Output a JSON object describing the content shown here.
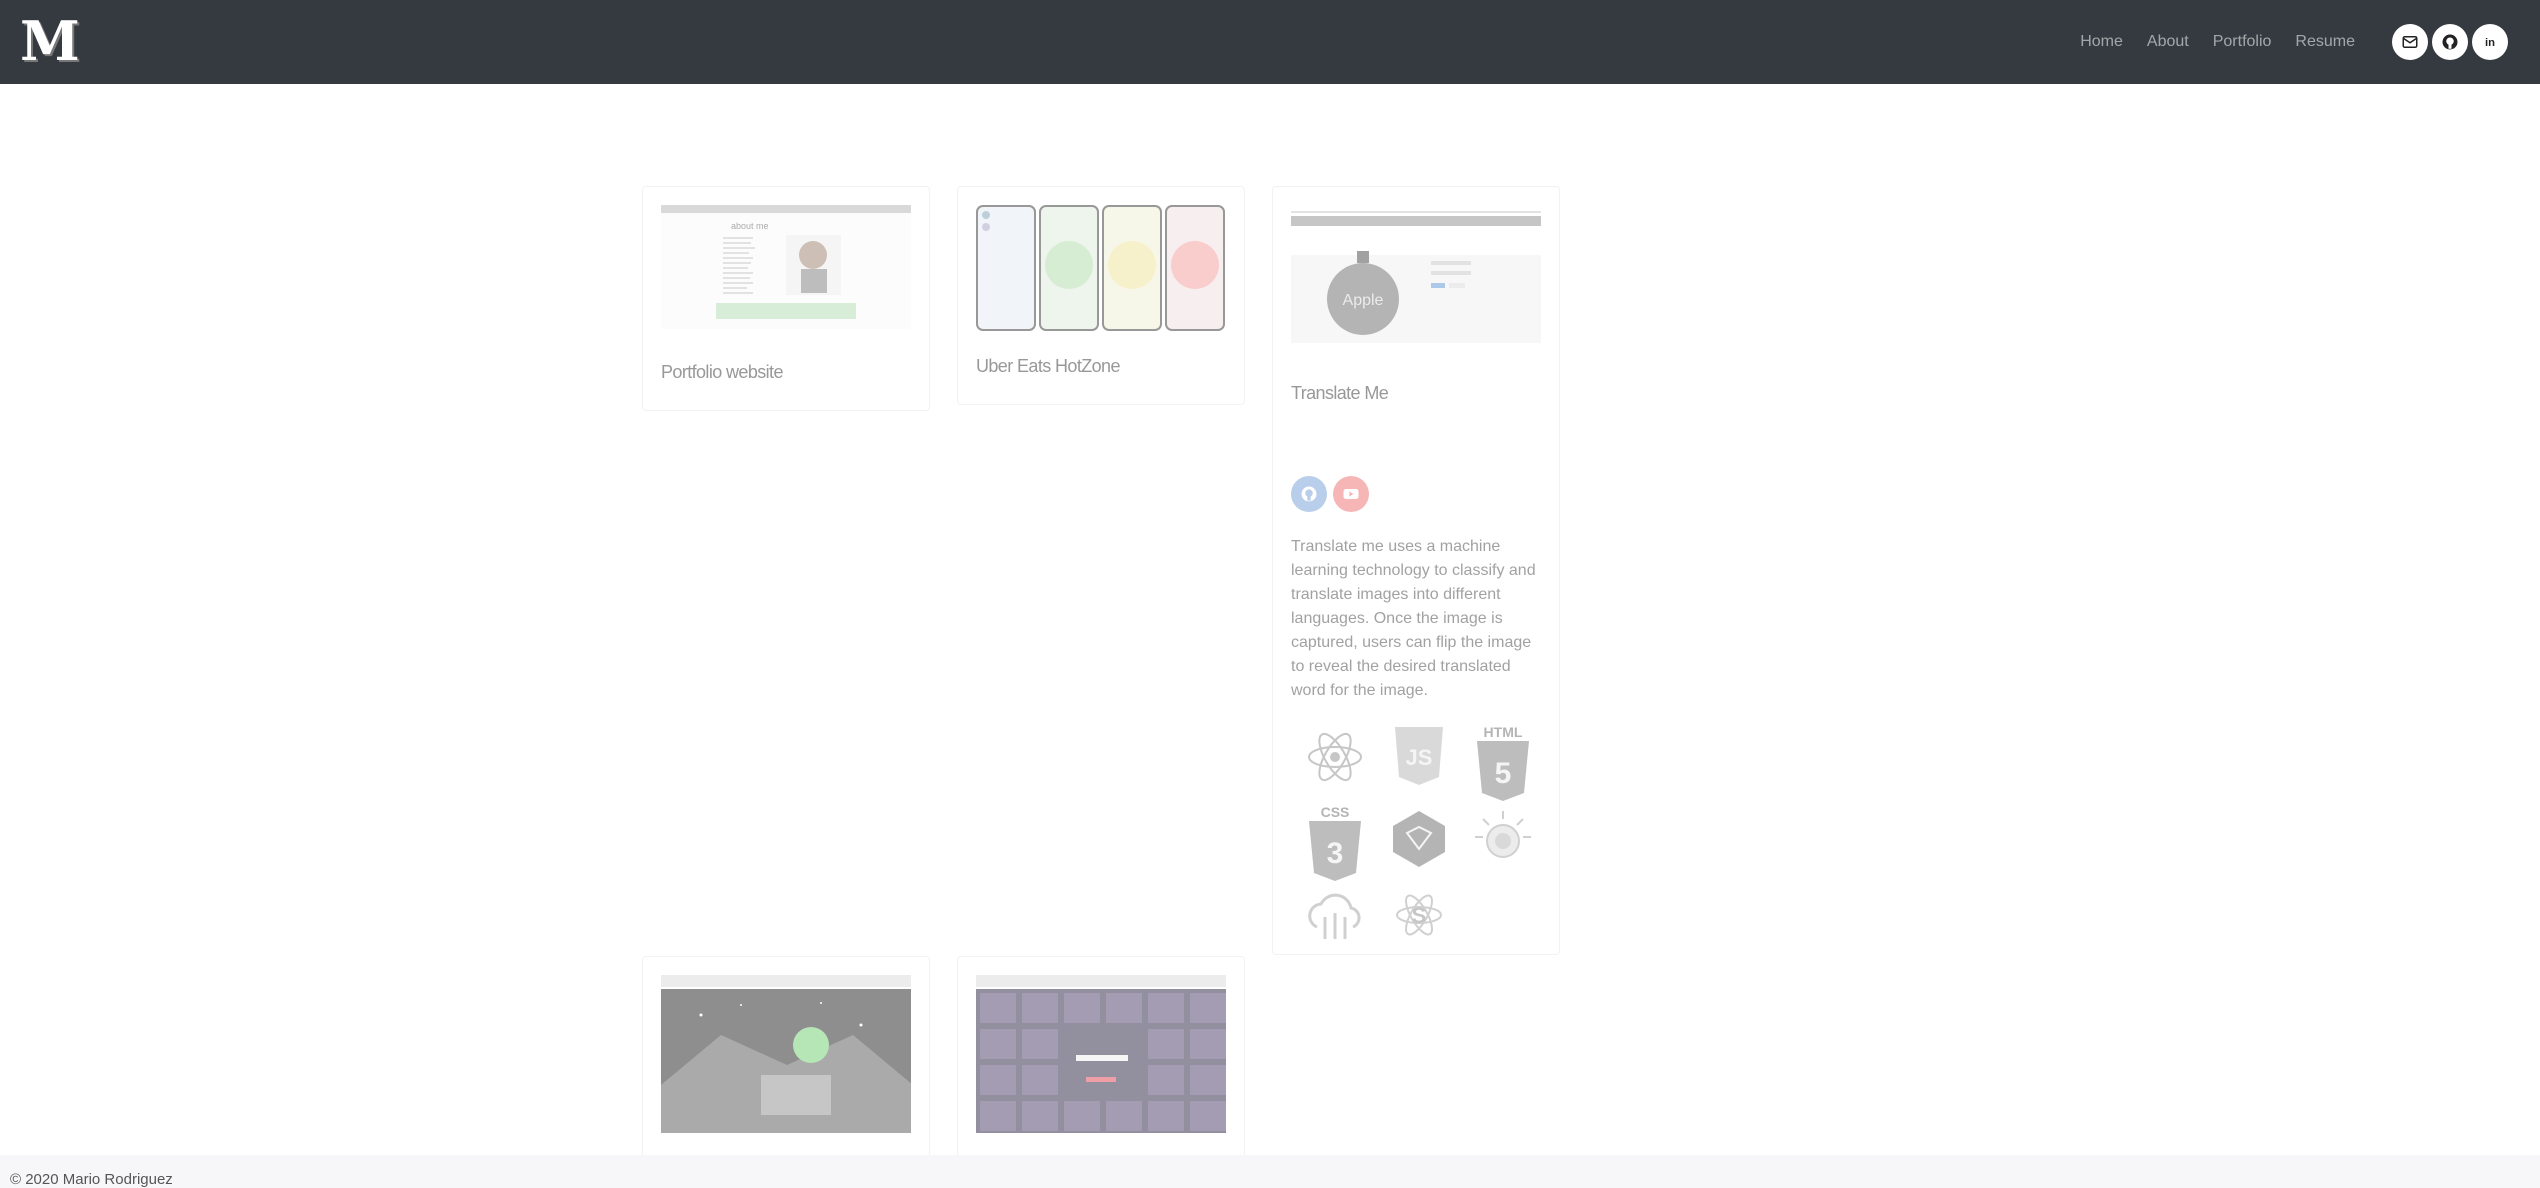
{
  "header": {
    "logo": "M",
    "nav": [
      "Home",
      "About",
      "Portfolio",
      "Resume"
    ],
    "social_icons": [
      "mail-icon",
      "github-icon",
      "linkedin-icon"
    ]
  },
  "projects": [
    {
      "title": "Portfolio website",
      "image_caption": "about me"
    },
    {
      "title": "Uber Eats HotZone"
    },
    {
      "title": "Translate Me",
      "image_caption": "Apple",
      "links": [
        "github-icon",
        "youtube-icon"
      ],
      "description": "Translate me uses a machine learning technology to classify and translate images into different languages. Once the image is captured, users can flip the image to reveal the desired translated word for the image.",
      "tech": [
        {
          "icon": "react-icon",
          "label": ""
        },
        {
          "icon": "javascript-icon",
          "label": "JS"
        },
        {
          "icon": "html5-icon",
          "label": "HTML"
        },
        {
          "icon": "css3-icon",
          "label": "CSS"
        },
        {
          "icon": "sketch-icon",
          "label": ""
        },
        {
          "icon": "ibm-watson-icon",
          "label": ""
        },
        {
          "icon": "cloud-icon",
          "label": ""
        },
        {
          "icon": "saga-icon",
          "label": "S"
        }
      ]
    },
    {
      "title": ""
    },
    {
      "title": ""
    }
  ],
  "footer": {
    "copyright": "© 2020 Mario Rodriguez"
  },
  "colors": {
    "navbar": "#343a40",
    "github_btn": "#7fa7db",
    "youtube_btn": "#f27c7c"
  }
}
